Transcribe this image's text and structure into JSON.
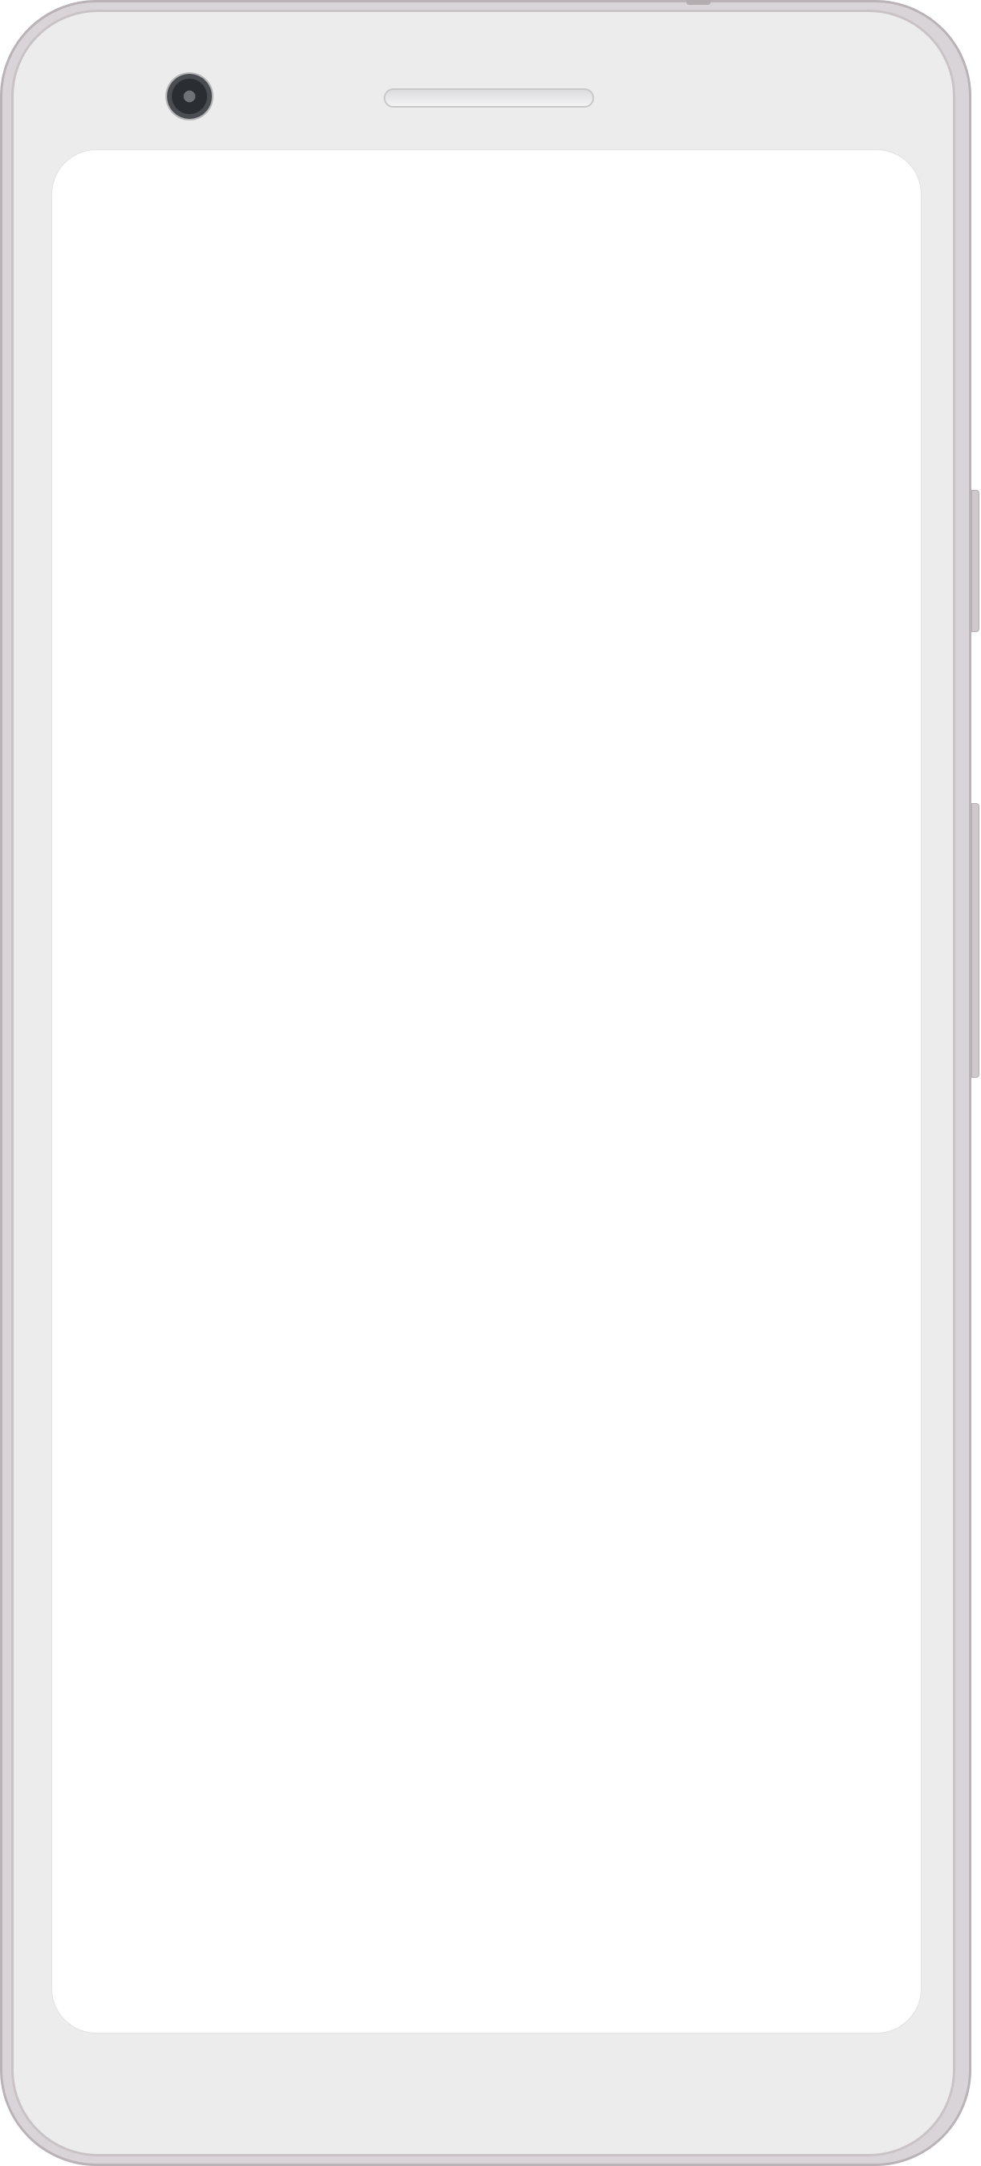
{
  "device": {
    "type": "smartphone-mockup",
    "frame_color": "#d9d4d7",
    "bezel_color": "#ececed",
    "screen_color": "#ffffff",
    "icons": {
      "camera": "front-camera-icon",
      "speaker": "earpiece-speaker-icon"
    }
  }
}
